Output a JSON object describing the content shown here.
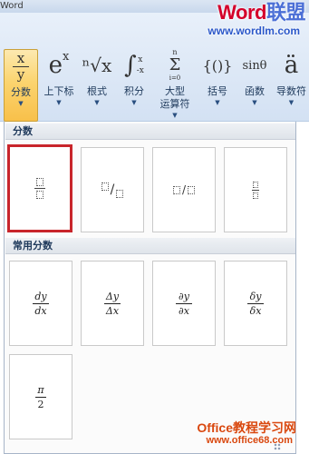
{
  "window": {
    "title": "Word"
  },
  "watermark": {
    "logo_part1": "Word",
    "logo_part2": "联盟",
    "url": "www.wordlm.com",
    "bottom_text": "Office教程学习网",
    "bottom_url": "www.office68.com"
  },
  "ribbon": {
    "buttons": [
      {
        "key": "fraction",
        "label": "分数",
        "label2": "",
        "icon": "fraction-icon",
        "glyph_top": "x",
        "glyph_bottom": "y",
        "has_menu": true,
        "active": true
      },
      {
        "key": "script",
        "label": "上下标",
        "label2": "",
        "icon": "superscript-icon",
        "glyph": "e",
        "glyph_sup": "x",
        "has_menu": true,
        "active": false
      },
      {
        "key": "radical",
        "label": "根式",
        "label2": "",
        "icon": "radical-icon",
        "glyph": "ⁿ√x",
        "has_menu": true,
        "active": false
      },
      {
        "key": "integral",
        "label": "积分",
        "label2": "",
        "icon": "integral-icon",
        "glyph": "∫",
        "glyph_top": "x",
        "glyph_bottom": "-x",
        "has_menu": true,
        "active": false
      },
      {
        "key": "large-operator",
        "label": "大型",
        "label2": "运算符",
        "icon": "summation-icon",
        "glyph": "Σ",
        "glyph_top": "n",
        "glyph_bottom": "i=0",
        "has_menu": true,
        "active": false
      },
      {
        "key": "bracket",
        "label": "括号",
        "label2": "",
        "icon": "bracket-icon",
        "glyph": "{()}",
        "has_menu": true,
        "active": false
      },
      {
        "key": "function",
        "label": "函数",
        "label2": "",
        "icon": "function-icon",
        "glyph": "sinθ",
        "has_menu": true,
        "active": false
      },
      {
        "key": "accent",
        "label": "导数符",
        "label2": "",
        "icon": "accent-icon",
        "glyph": "ä",
        "has_menu": true,
        "active": false
      }
    ]
  },
  "gallery": {
    "sections": [
      {
        "title": "分数"
      },
      {
        "title": "常用分数"
      }
    ],
    "common_fractions": [
      {
        "num": "dy",
        "den": "dx"
      },
      {
        "num": "Δy",
        "den": "Δx"
      },
      {
        "num": "∂y",
        "den": "∂x"
      },
      {
        "num": "δy",
        "den": "δx"
      },
      {
        "num": "π",
        "den": "2"
      }
    ],
    "slash_symbol": "/"
  },
  "colors": {
    "selection_border": "#c8252b",
    "active_button": "#fbd46f",
    "ribbon_text": "#1e395b"
  }
}
